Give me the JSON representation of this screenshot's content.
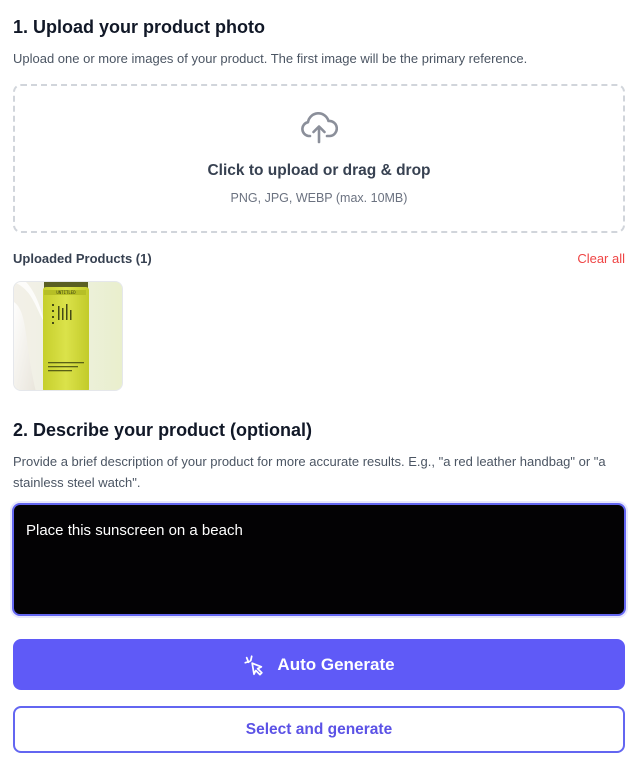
{
  "step1": {
    "title": "1. Upload your product photo",
    "hint": "Upload one or more images of your product. The first image will be the primary reference."
  },
  "dropzone": {
    "icon": "cloud-upload-icon",
    "main_text": "Click to upload or drag & drop",
    "sub_text": "PNG, JPG, WEBP (max. 10MB)"
  },
  "uploaded": {
    "label": "Uploaded Products (1)",
    "clear_all": "Clear all",
    "items": [
      {
        "kind": "sunscreen-tube-thumbnail",
        "tube_color": "#d4dc3a"
      }
    ]
  },
  "step2": {
    "title": "2. Describe your product (optional)",
    "hint": "Provide a brief description of your product for more accurate results. E.g., \"a red leather handbag\" or \"a stainless steel watch\".",
    "value": "Place this sunscreen on a beach"
  },
  "actions": {
    "auto_generate": "Auto Generate",
    "auto_generate_icon": "sparkle-cursor-icon",
    "select_generate": "Select and generate"
  },
  "colors": {
    "accent": "#5f5af7",
    "danger": "#ef4444",
    "textarea_bg": "#030204"
  }
}
